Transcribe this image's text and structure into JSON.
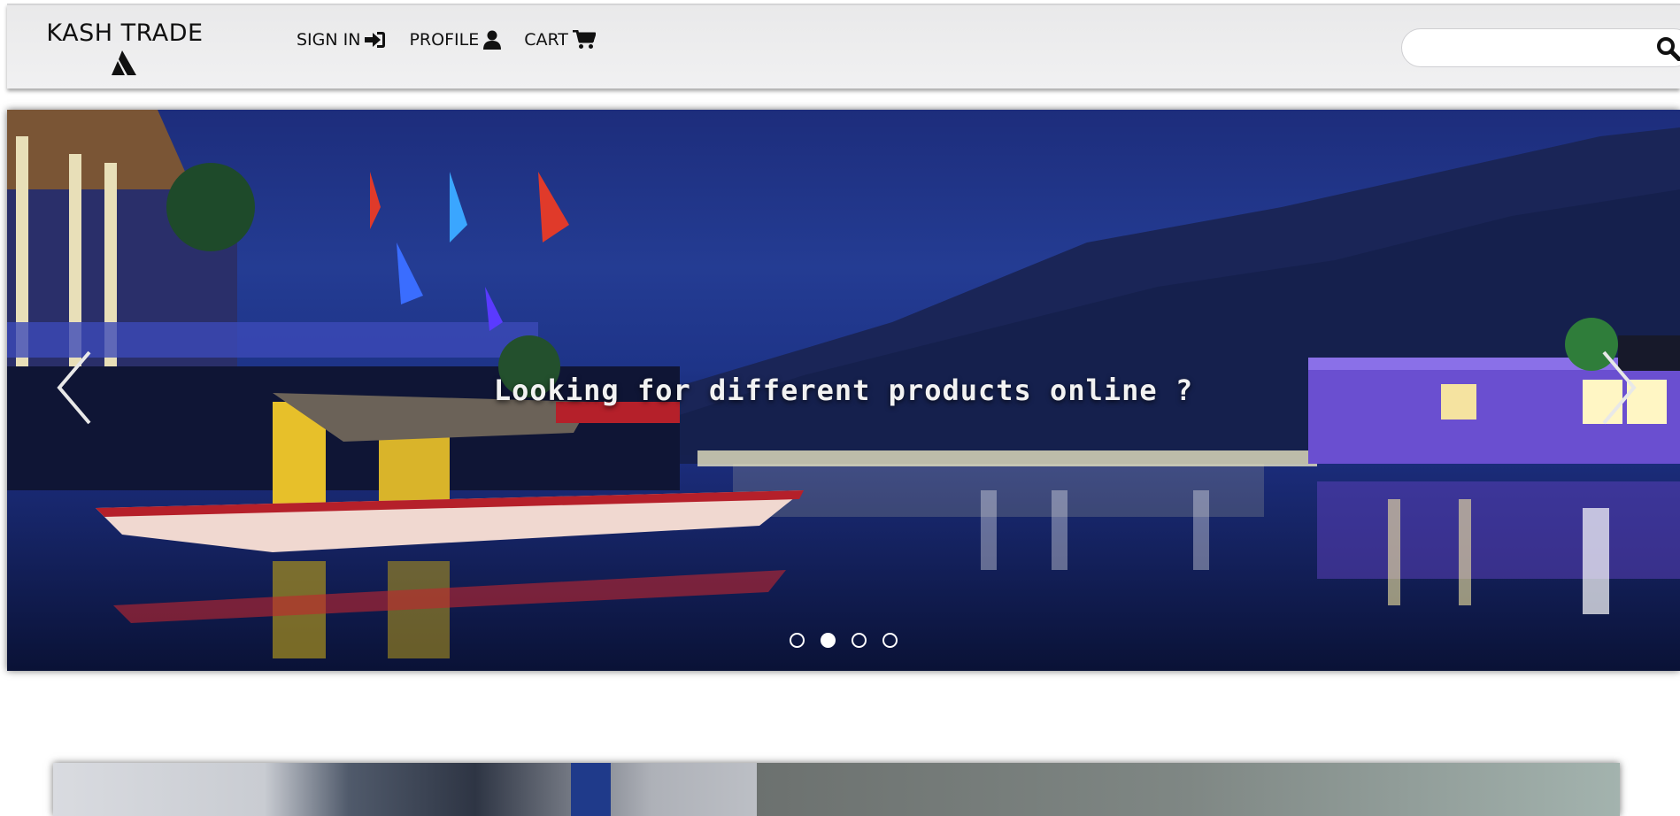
{
  "navbar": {
    "brand_name": "KASH TRADE",
    "brand_logo_icon": "mountain-logo-icon",
    "links": [
      {
        "label": "SIGN IN",
        "icon": "sign-in-icon"
      },
      {
        "label": "PROFILE",
        "icon": "user-icon"
      },
      {
        "label": "CART",
        "icon": "shopping-cart-icon"
      }
    ],
    "search": {
      "value": "",
      "placeholder": "",
      "icon": "search-icon"
    }
  },
  "carousel": {
    "caption": "Looking for different products online ?",
    "slide_count": 4,
    "active_slide": 2,
    "prev_icon": "chevron-left-icon",
    "next_icon": "chevron-right-icon"
  }
}
